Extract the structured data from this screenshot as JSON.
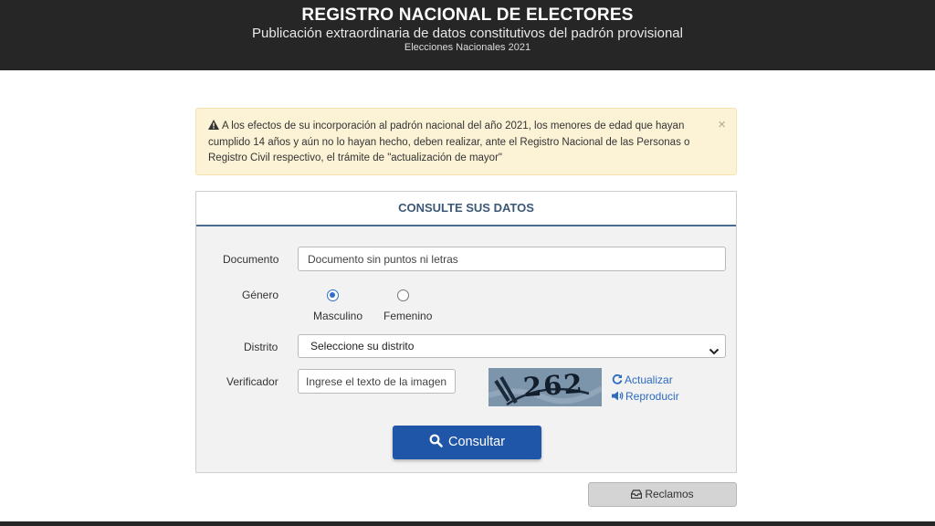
{
  "header": {
    "title": "REGISTRO NACIONAL DE ELECTORES",
    "subtitle": "Publicación extraordinaria de datos constitutivos del padrón provisional",
    "election": "Elecciones Nacionales 2021"
  },
  "alert": {
    "text": "A los efectos de su incorporación al padrón nacional del año 2021, los menores de edad que hayan cumplido 14 años y aún no lo hayan hecho, deben realizar, ante el Registro Nacional de las Personas o Registro Civil respectivo, el trámite de \"actualización de mayor\"",
    "close": "×"
  },
  "form": {
    "heading": "CONSULTE SUS DATOS",
    "documento": {
      "label": "Documento",
      "placeholder": "Documento sin puntos ni letras"
    },
    "genero": {
      "label": "Género",
      "options": [
        "Masculino",
        "Femenino"
      ],
      "selected": "Masculino"
    },
    "distrito": {
      "label": "Distrito",
      "selected": "Seleccione su distrito"
    },
    "verificador": {
      "label": "Verificador",
      "placeholder": "Ingrese el texto de la imagen",
      "captcha_text": "262",
      "refresh_label": "Actualizar",
      "audio_label": "Reproducir"
    },
    "submit_label": "Consultar"
  },
  "reclamos_label": "Reclamos",
  "icons": {
    "alert": "warning-icon",
    "submit": "search-icon",
    "refresh": "refresh-icon",
    "audio": "speaker-icon",
    "reclamos": "inbox-icon",
    "select": "chevron-down-icon"
  },
  "colors": {
    "header_bg": "#262626",
    "alert_bg": "#fcf3d6",
    "primary_button": "#2056a8",
    "link": "#2d6bbf",
    "panel_heading": "#3c5877"
  }
}
